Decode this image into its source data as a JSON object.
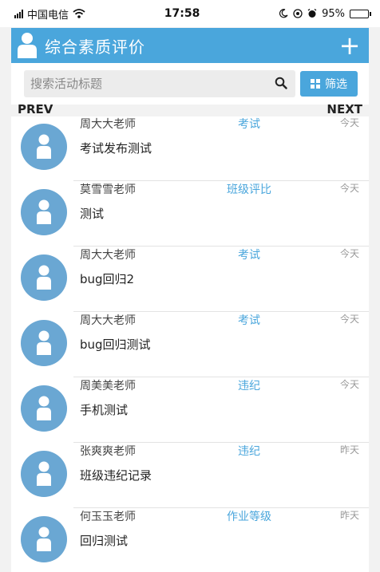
{
  "status_bar": {
    "carrier": "中国电信",
    "time": "17:58",
    "battery": "95%",
    "battery_level": 0.95
  },
  "header": {
    "title": "综合素质评价",
    "add_label": "+"
  },
  "search": {
    "placeholder": "搜索活动标题",
    "filter_label": "筛选"
  },
  "pager": {
    "prev": "PREV",
    "next": "NEXT"
  },
  "colors": {
    "accent": "#4aa6dc",
    "avatar": "#6aa7d3"
  },
  "items": [
    {
      "teacher": "周大大老师",
      "category": "考试",
      "date": "今天",
      "title": "考试发布测试"
    },
    {
      "teacher": "莫雪雪老师",
      "category": "班级评比",
      "date": "今天",
      "title": "测试"
    },
    {
      "teacher": "周大大老师",
      "category": "考试",
      "date": "今天",
      "title": "bug回归2"
    },
    {
      "teacher": "周大大老师",
      "category": "考试",
      "date": "今天",
      "title": "bug回归测试"
    },
    {
      "teacher": "周美美老师",
      "category": "违纪",
      "date": "今天",
      "title": "手机测试"
    },
    {
      "teacher": "张爽爽老师",
      "category": "违纪",
      "date": "昨天",
      "title": "班级违纪记录"
    },
    {
      "teacher": "何玉玉老师",
      "category": "作业等级",
      "date": "昨天",
      "title": "回归测试"
    }
  ]
}
